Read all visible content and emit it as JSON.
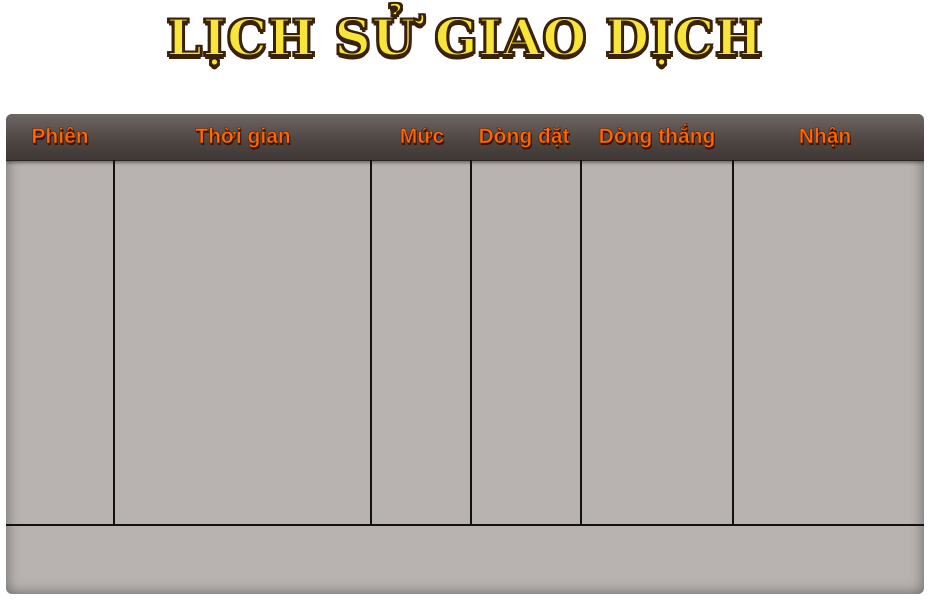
{
  "title": "LỊCH SỬ GIAO DỊCH",
  "table": {
    "headers": [
      "Phiên",
      "Thời gian",
      "Mức",
      "Dòng đặt",
      "Dòng thắng",
      "Nhận"
    ],
    "rows": []
  },
  "colors": {
    "title_fill": "#f8e53a",
    "title_outline": "#3a2208",
    "header_text": "#ff6a00",
    "header_bg": "#4d4542",
    "panel_bg": "#b8b3b0",
    "grid_line": "#111111"
  }
}
